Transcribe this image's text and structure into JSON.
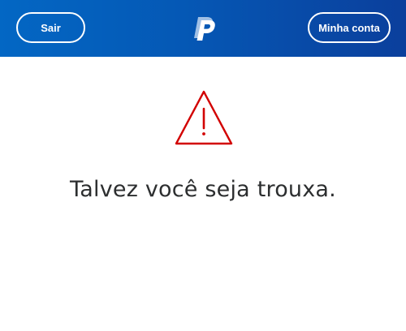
{
  "header": {
    "logout_label": "Sair",
    "account_label": "Minha conta",
    "logo_icon": "paypal-logo",
    "background_color": "#0558b5"
  },
  "main": {
    "alert_icon": "warning-triangle-icon",
    "alert_color": "#d20000",
    "message": "Talvez você seja trouxa."
  }
}
